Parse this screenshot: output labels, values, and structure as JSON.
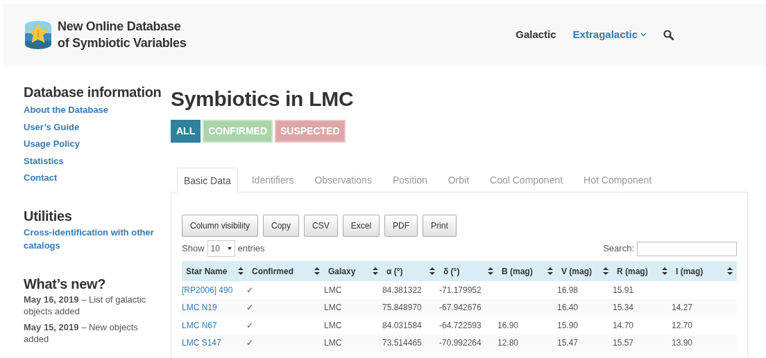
{
  "header": {
    "logo_title": "New Online Database",
    "logo_subtitle": "of Symbiotic Variables",
    "nav": [
      {
        "label": "Galactic",
        "selected": false,
        "dropdown": false
      },
      {
        "label": "Extragalactic",
        "selected": true,
        "dropdown": true
      }
    ]
  },
  "sidebar": [
    {
      "heading": "Database information",
      "links": [
        "About the Database",
        "User’s Guide",
        "Usage Policy",
        "Statistics",
        "Contact"
      ]
    },
    {
      "heading": "Utilities",
      "links": [
        "Cross-identification with other catalogs"
      ]
    },
    {
      "heading": "What’s new?",
      "news": [
        {
          "date": "May 16, 2019",
          "text": "– List of galactic objects added"
        },
        {
          "date": "May 15, 2019",
          "text": "– New objects added"
        }
      ]
    }
  ],
  "page_title": "Symbiotics in LMC",
  "filters": [
    {
      "label": "ALL",
      "selected": true,
      "color": "#31809e"
    },
    {
      "label": "CONFIRMED",
      "selected": false,
      "color": "#a9d5a9"
    },
    {
      "label": "SUSPECTED",
      "selected": false,
      "color": "#dea6a6"
    }
  ],
  "tabs": [
    {
      "label": "Basic Data",
      "selected": true
    },
    {
      "label": "Identifiers",
      "selected": false
    },
    {
      "label": "Observations",
      "selected": false
    },
    {
      "label": "Position",
      "selected": false
    },
    {
      "label": "Orbit",
      "selected": false
    },
    {
      "label": "Cool Component",
      "selected": false
    },
    {
      "label": "Hot Component",
      "selected": false
    }
  ],
  "export_buttons": [
    "Column visibility",
    "Copy",
    "CSV",
    "Excel",
    "PDF",
    "Print"
  ],
  "length": {
    "before": "Show",
    "value": "10",
    "after": "entries"
  },
  "search": {
    "label": "Search:"
  },
  "table": {
    "columns": [
      "Star Name",
      "Confirmed",
      "Galaxy",
      "α (°)",
      "δ (°)",
      "B (mag)",
      "V (mag)",
      "R (mag)",
      "I (mag)"
    ],
    "rows": [
      [
        "[RP2006] 490",
        "✓",
        "LMC",
        "84.381322",
        "-71.179952",
        "",
        "16.98",
        "15.91",
        ""
      ],
      [
        "LMC N19",
        "✓",
        "LMC",
        "75.848970",
        "-67.942676",
        "",
        "16.40",
        "15.34",
        "14.27"
      ],
      [
        "LMC N67",
        "✓",
        "LMC",
        "84.031584",
        "-64.722593",
        "16.90",
        "15.90",
        "14.70",
        "12.70"
      ],
      [
        "LMC S147",
        "✓",
        "LMC",
        "73.514465",
        "-70.992264",
        "12.80",
        "15.47",
        "15.57",
        "13.90"
      ]
    ]
  }
}
